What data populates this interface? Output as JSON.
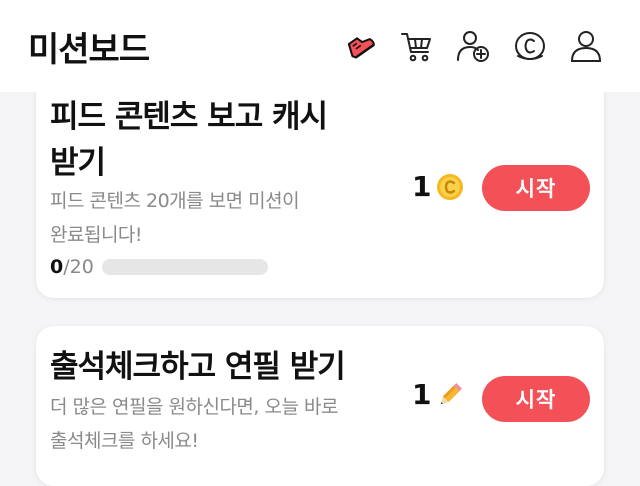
{
  "header": {
    "title": "미션보드",
    "icons": [
      "sneaker-icon",
      "cart-icon",
      "add-friend-icon",
      "coin-icon",
      "profile-icon"
    ],
    "brand_color": "#f45058"
  },
  "missions": [
    {
      "title_line1": "피드 콘텐츠 보고 캐시",
      "title_line2": "받기",
      "desc_line1": "피드 콘텐츠 20개를 보면 미션이",
      "desc_line2": "완료됩니다!",
      "progress_current": "0",
      "progress_total": "/20",
      "progress_fraction": 0,
      "reward_amount": "1",
      "reward_icon": "cash-coin-icon",
      "button_label": "시작"
    },
    {
      "title_line1": "출석체크하고 연필 받기",
      "desc_line1": "더 많은 연필을 원하신다면, 오늘 바로",
      "desc_line2": "출석체크를 하세요!",
      "reward_amount": "1",
      "reward_icon": "pencil-icon",
      "button_label": "시작"
    }
  ]
}
